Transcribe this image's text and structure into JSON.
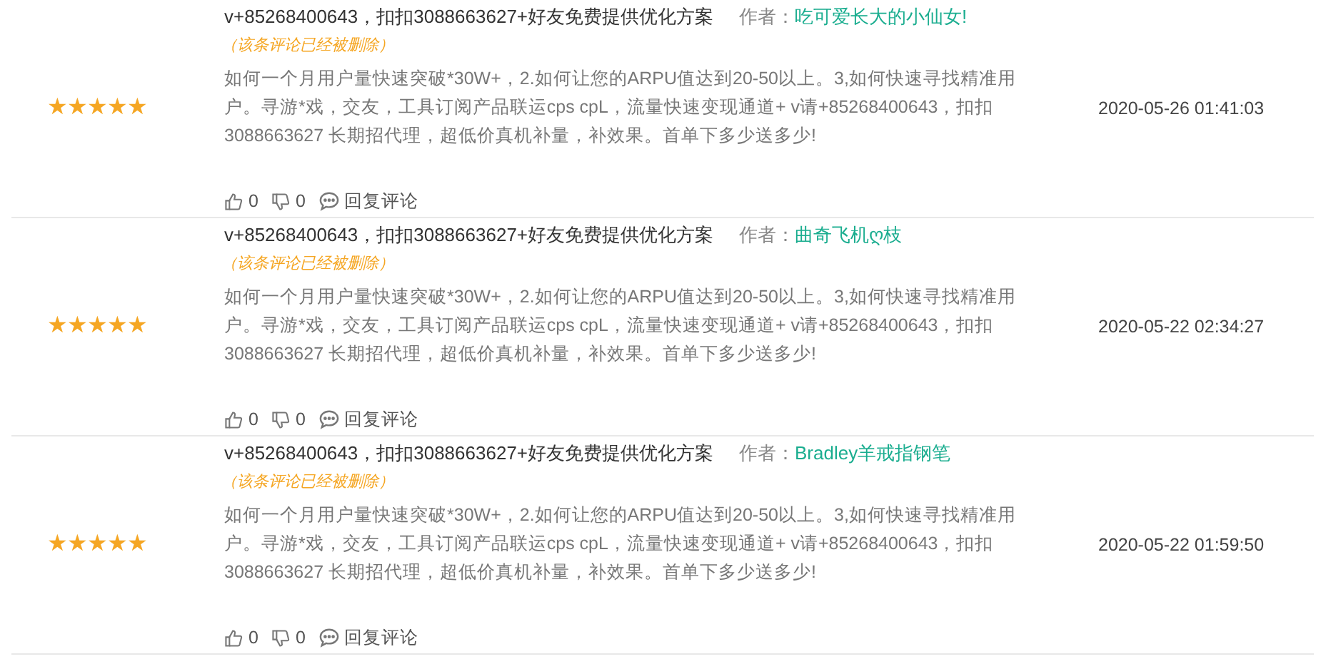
{
  "comments": [
    {
      "stars": 5,
      "title": "v+85268400643，扣扣3088663627+好友免费提供优化方案",
      "author_label": "作者：",
      "author": "吃可爱长大的小仙女!",
      "deleted_note": "（该条评论已经被删除）",
      "body": "如何一个月用户量快速突破*30W+，2.如何让您的ARPU值达到20-50以上。3,如何快速寻找精准用户。寻游*戏，交友，工具订阅产品联运cps cpL，流量快速变现通道+ v请+85268400643，扣扣3088663627 长期招代理，超低价真机补量，补效果。首单下多少送多少!",
      "date": "2020-05-26 01:41:03",
      "likes": "0",
      "dislikes": "0",
      "reply": "回复评论"
    },
    {
      "stars": 5,
      "title": "v+85268400643，扣扣3088663627+好友免费提供优化方案",
      "author_label": "作者：",
      "author": "曲奇飞机ღ枝",
      "deleted_note": "（该条评论已经被删除）",
      "body": "如何一个月用户量快速突破*30W+，2.如何让您的ARPU值达到20-50以上。3,如何快速寻找精准用户。寻游*戏，交友，工具订阅产品联运cps cpL，流量快速变现通道+ v请+85268400643，扣扣3088663627 长期招代理，超低价真机补量，补效果。首单下多少送多少!",
      "date": "2020-05-22 02:34:27",
      "likes": "0",
      "dislikes": "0",
      "reply": "回复评论"
    },
    {
      "stars": 5,
      "title": "v+85268400643，扣扣3088663627+好友免费提供优化方案",
      "author_label": "作者：",
      "author": "Bradley羊戒指钢笔",
      "deleted_note": "（该条评论已经被删除）",
      "body": "如何一个月用户量快速突破*30W+，2.如何让您的ARPU值达到20-50以上。3,如何快速寻找精准用户。寻游*戏，交友，工具订阅产品联运cps cpL，流量快速变现通道+ v请+85268400643，扣扣3088663627 长期招代理，超低价真机补量，补效果。首单下多少送多少!",
      "date": "2020-05-22 01:59:50",
      "likes": "0",
      "dislikes": "0",
      "reply": "回复评论"
    }
  ]
}
